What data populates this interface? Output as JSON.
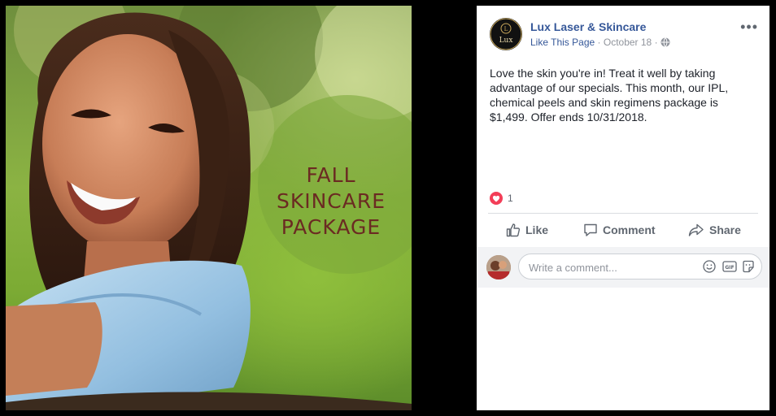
{
  "photo": {
    "headline_lines": [
      "FALL",
      "SKINCARE",
      "PACKAGE"
    ]
  },
  "post": {
    "page_name": "Lux Laser & Skincare",
    "logo_text": "Lux",
    "like_page_label": "Like This Page",
    "separator": "·",
    "date": "October 18",
    "privacy_icon": "globe-icon",
    "more_label": "•••",
    "text": "Love the skin you're in! Treat it well by taking advantage of our specials. This month, our IPL, chemical peels and skin regimens package is $1,499. Offer ends 10/31/2018.",
    "reaction_icon": "heart-icon",
    "reaction_count": "1"
  },
  "actions": {
    "like_label": "Like",
    "comment_label": "Comment",
    "share_label": "Share"
  },
  "comment": {
    "placeholder": "Write a comment...",
    "emoji_icon": "smiley-icon",
    "gif_label": "GIF",
    "sticker_icon": "sticker-icon"
  },
  "colors": {
    "link_blue": "#365899",
    "headline_brown": "#6b2a22",
    "heart_red": "#f33e58",
    "secondary_gray": "#90949c"
  }
}
